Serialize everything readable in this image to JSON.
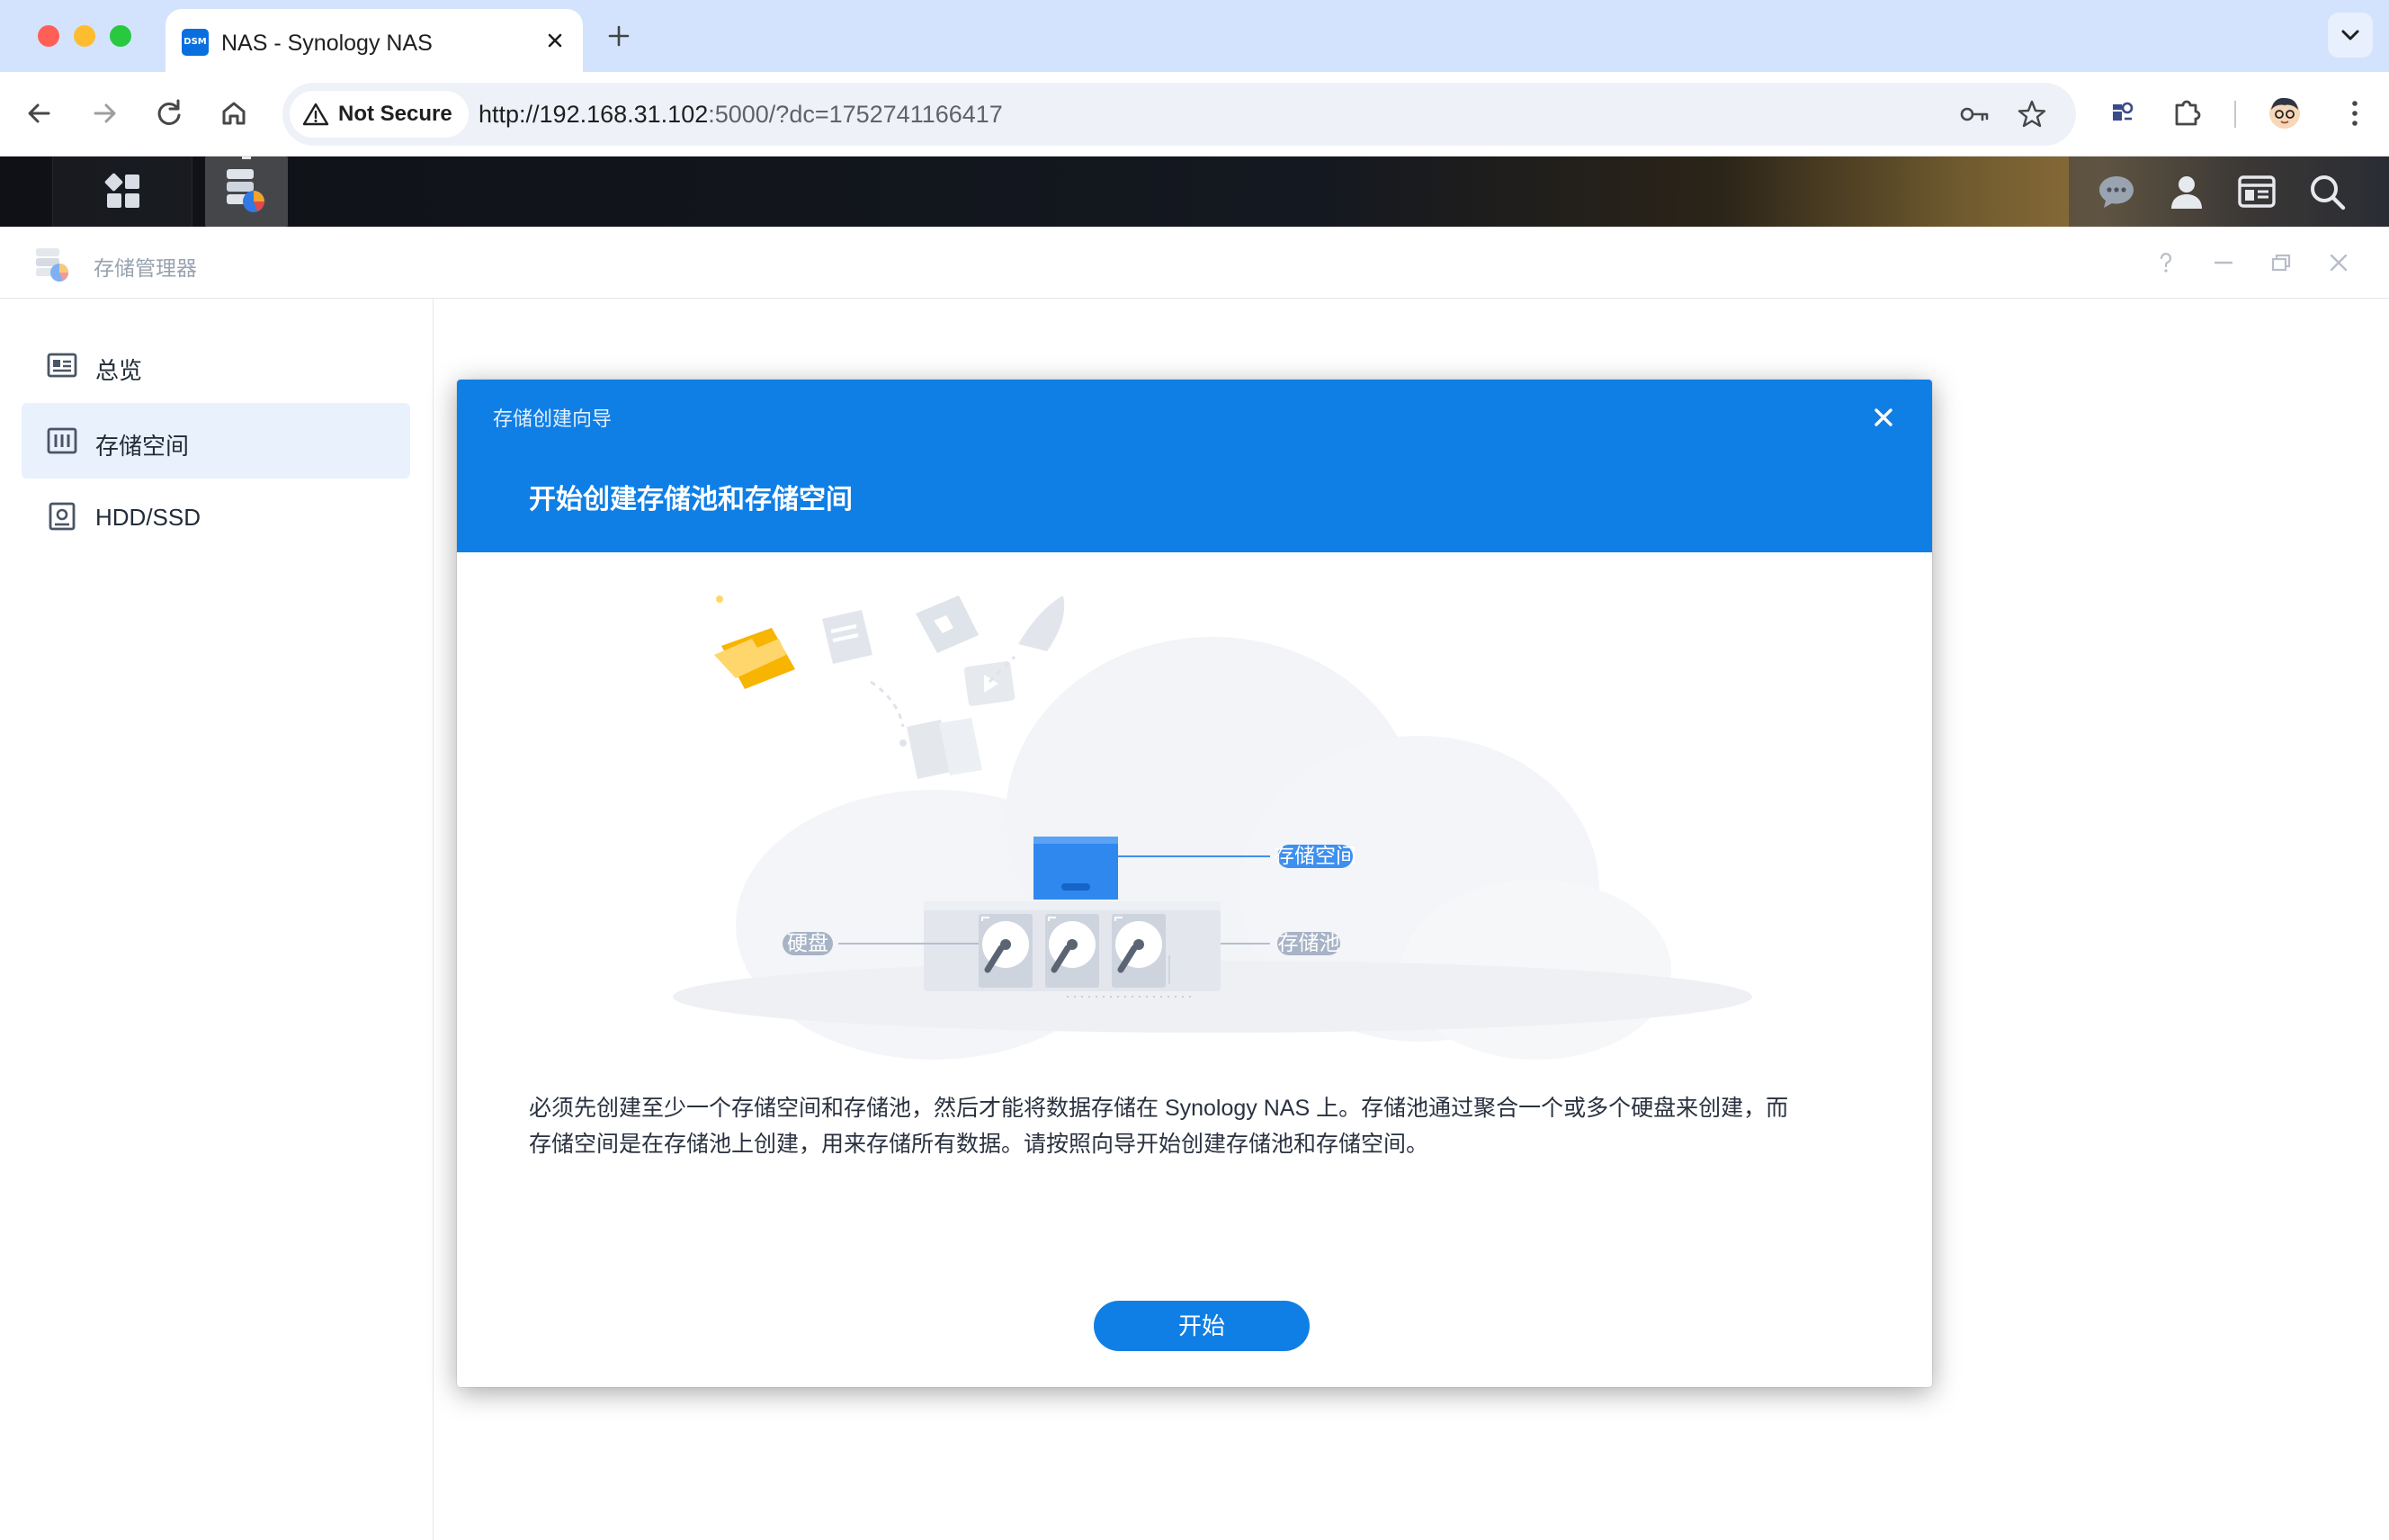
{
  "browser": {
    "tab_title": "NAS - Synology NAS",
    "tab_favicon_text": "DSM",
    "security_label": "Not Secure",
    "url_host": "http://192.168.31.102",
    "url_rest": ":5000/?dc=1752741166417"
  },
  "app": {
    "title": "存储管理器"
  },
  "sidebar": {
    "items": [
      {
        "label": "总览",
        "icon": "overview-icon",
        "active": false
      },
      {
        "label": "存储空间",
        "icon": "volume-icon",
        "active": true
      },
      {
        "label": "HDD/SSD",
        "icon": "hdd-icon",
        "active": false
      }
    ]
  },
  "wizard": {
    "caption": "存储创建向导",
    "heading": "开始创建存储池和存储空间",
    "illustration": {
      "volume_label": "存储空间",
      "disk_label": "硬盘",
      "pool_label": "存储池"
    },
    "description": [
      "必须先创建至少一个存储空间和存储池，然后才能将数据存储在 Synology NAS 上。存储池通过聚合一个或多个硬盘来创建，而",
      "存储空间是在存储池上创建，用来存储所有数据。请按照向导开始创建存储池和存储空间。"
    ],
    "start_label": "开始"
  },
  "colors": {
    "accent": "#0f7fe6",
    "tabstrip": "#d3e3fd",
    "sidebar_active": "#e9f1fc",
    "label_volume": "#3d8ff0",
    "label_gray": "#a7b3c6"
  }
}
